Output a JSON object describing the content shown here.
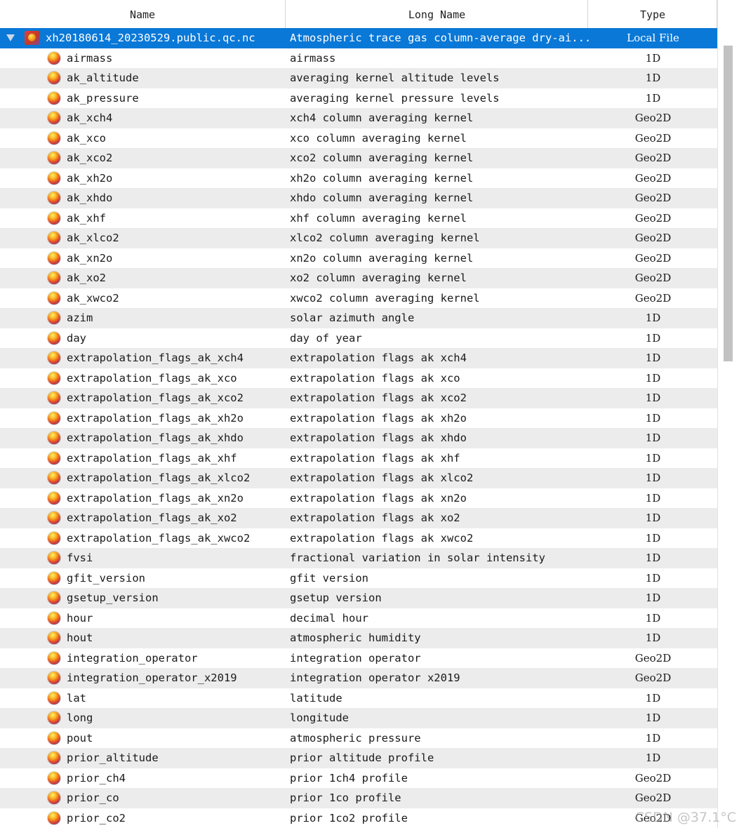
{
  "columns": {
    "name": "Name",
    "long_name": "Long Name",
    "type": "Type"
  },
  "file_row": {
    "name": "xh20180614_20230529.public.qc.nc",
    "long_name": "Atmospheric trace gas column-average dry-ai...",
    "type": "Local File"
  },
  "rows": [
    {
      "name": "airmass",
      "long_name": "airmass",
      "type": "1D"
    },
    {
      "name": "ak_altitude",
      "long_name": "averaging kernel altitude levels",
      "type": "1D"
    },
    {
      "name": "ak_pressure",
      "long_name": "averaging kernel pressure levels",
      "type": "1D"
    },
    {
      "name": "ak_xch4",
      "long_name": "xch4 column averaging kernel",
      "type": "Geo2D"
    },
    {
      "name": "ak_xco",
      "long_name": "xco column averaging kernel",
      "type": "Geo2D"
    },
    {
      "name": "ak_xco2",
      "long_name": "xco2 column averaging kernel",
      "type": "Geo2D"
    },
    {
      "name": "ak_xh2o",
      "long_name": "xh2o column averaging kernel",
      "type": "Geo2D"
    },
    {
      "name": "ak_xhdo",
      "long_name": "xhdo column averaging kernel",
      "type": "Geo2D"
    },
    {
      "name": "ak_xhf",
      "long_name": "xhf column averaging kernel",
      "type": "Geo2D"
    },
    {
      "name": "ak_xlco2",
      "long_name": "xlco2 column averaging kernel",
      "type": "Geo2D"
    },
    {
      "name": "ak_xn2o",
      "long_name": "xn2o column averaging kernel",
      "type": "Geo2D"
    },
    {
      "name": "ak_xo2",
      "long_name": "xo2 column averaging kernel",
      "type": "Geo2D"
    },
    {
      "name": "ak_xwco2",
      "long_name": "xwco2 column averaging kernel",
      "type": "Geo2D"
    },
    {
      "name": "azim",
      "long_name": "solar azimuth angle",
      "type": "1D"
    },
    {
      "name": "day",
      "long_name": "day of year",
      "type": "1D"
    },
    {
      "name": "extrapolation_flags_ak_xch4",
      "long_name": "extrapolation flags ak xch4",
      "type": "1D"
    },
    {
      "name": "extrapolation_flags_ak_xco",
      "long_name": "extrapolation flags ak xco",
      "type": "1D"
    },
    {
      "name": "extrapolation_flags_ak_xco2",
      "long_name": "extrapolation flags ak xco2",
      "type": "1D"
    },
    {
      "name": "extrapolation_flags_ak_xh2o",
      "long_name": "extrapolation flags ak xh2o",
      "type": "1D"
    },
    {
      "name": "extrapolation_flags_ak_xhdo",
      "long_name": "extrapolation flags ak xhdo",
      "type": "1D"
    },
    {
      "name": "extrapolation_flags_ak_xhf",
      "long_name": "extrapolation flags ak xhf",
      "type": "1D"
    },
    {
      "name": "extrapolation_flags_ak_xlco2",
      "long_name": "extrapolation flags ak xlco2",
      "type": "1D"
    },
    {
      "name": "extrapolation_flags_ak_xn2o",
      "long_name": "extrapolation flags ak xn2o",
      "type": "1D"
    },
    {
      "name": "extrapolation_flags_ak_xo2",
      "long_name": "extrapolation flags ak xo2",
      "type": "1D"
    },
    {
      "name": "extrapolation_flags_ak_xwco2",
      "long_name": "extrapolation flags ak xwco2",
      "type": "1D"
    },
    {
      "name": "fvsi",
      "long_name": "fractional variation in solar intensity",
      "type": "1D"
    },
    {
      "name": "gfit_version",
      "long_name": "gfit version",
      "type": "1D"
    },
    {
      "name": "gsetup_version",
      "long_name": "gsetup version",
      "type": "1D"
    },
    {
      "name": "hour",
      "long_name": "decimal hour",
      "type": "1D"
    },
    {
      "name": "hout",
      "long_name": "atmospheric humidity",
      "type": "1D"
    },
    {
      "name": "integration_operator",
      "long_name": "integration operator",
      "type": "Geo2D"
    },
    {
      "name": "integration_operator_x2019",
      "long_name": "integration operator x2019",
      "type": "Geo2D"
    },
    {
      "name": "lat",
      "long_name": "latitude",
      "type": "1D"
    },
    {
      "name": "long",
      "long_name": "longitude",
      "type": "1D"
    },
    {
      "name": "pout",
      "long_name": "atmospheric pressure",
      "type": "1D"
    },
    {
      "name": "prior_altitude",
      "long_name": "prior altitude profile",
      "type": "1D"
    },
    {
      "name": "prior_ch4",
      "long_name": "prior 1ch4 profile",
      "type": "Geo2D"
    },
    {
      "name": "prior_co",
      "long_name": "prior 1co profile",
      "type": "Geo2D"
    },
    {
      "name": "prior_co2",
      "long_name": "prior 1co2 profile",
      "type": "Geo2D"
    }
  ],
  "icons": {
    "file": "netcdf-file-icon",
    "variable": "variable-globe-icon",
    "expander": "expand-triangle-icon"
  },
  "colors": {
    "selection": "#0a78d7",
    "alt_row": "#ececec"
  },
  "watermark": "CSDN @37.1°C"
}
